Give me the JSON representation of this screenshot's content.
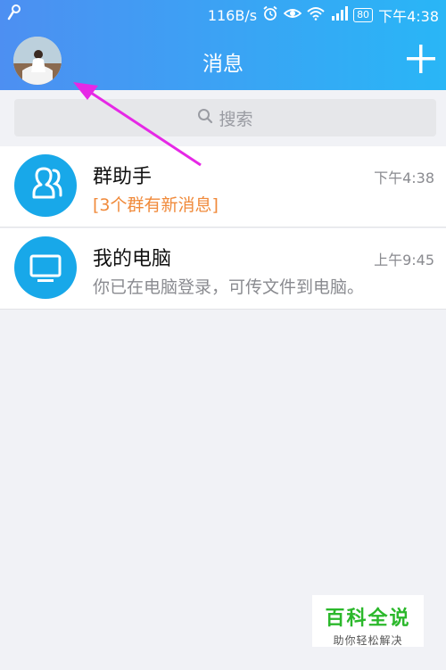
{
  "status_bar": {
    "speed": "116B/s",
    "battery": "80",
    "time": "下午4:38",
    "icons": [
      "key-icon",
      "alarm-icon",
      "eye-icon",
      "wifi-icon",
      "signal-icon",
      "battery-icon"
    ]
  },
  "header": {
    "title": "消息",
    "avatar_icon": "user-avatar",
    "add_icon": "plus-icon"
  },
  "search": {
    "placeholder": "搜索",
    "icon": "search-icon"
  },
  "chats": [
    {
      "name": "群助手",
      "time": "下午4:38",
      "preview": "[3个群有新消息]",
      "icon": "group-assistant-icon",
      "preview_color": "#f08a3b"
    },
    {
      "name": "我的电脑",
      "time": "上午9:45",
      "preview": "你已在电脑登录，可传文件到电脑。",
      "icon": "computer-icon"
    }
  ],
  "annotation": {
    "arrow_color": "#e628e6",
    "target": "avatar"
  },
  "watermark": {
    "main": "百科全说",
    "sub": "助你轻松解决",
    "color": "#2bb82b"
  },
  "colors": {
    "header_gradient_start": "#4d8ff2",
    "header_gradient_end": "#29b6f6",
    "icon_blue": "#18a8e9",
    "background": "#f1f2f6"
  }
}
